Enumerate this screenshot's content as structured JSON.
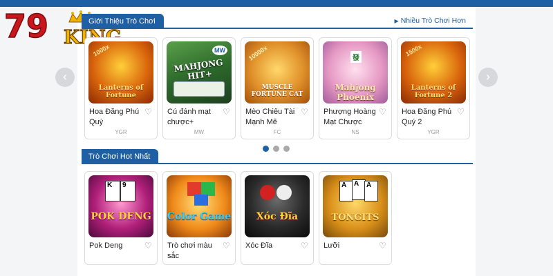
{
  "logo": {
    "text_79": "79",
    "text_king": "KING"
  },
  "intro_section": {
    "title": "Giới Thiệu Trò Chơi",
    "more_link": "Nhiều Trò Chơi Hơn",
    "cards": [
      {
        "name": "Hoa Đăng Phú Quý",
        "provider": "YGR",
        "thumb_title": "Lanterns of Fortune",
        "badge": "1000x"
      },
      {
        "name": "Cú đánh mạt chược+",
        "provider": "MW",
        "thumb_title": "MAHJONG HIT+",
        "badge": "MW"
      },
      {
        "name": "Mèo Chiêu Tài Mạnh Mẽ",
        "provider": "FC",
        "thumb_title": "MUSCLE FORTUNE CAT",
        "badge": "10000x"
      },
      {
        "name": "Phượng Hoàng Mạt Chược",
        "provider": "NS",
        "thumb_title": "Mahjong Phoenix",
        "badge": "發"
      },
      {
        "name": "Hoa Đăng Phú Quý 2",
        "provider": "YGR",
        "thumb_title": "Lanterns of Fortune 2",
        "badge": "1500x"
      }
    ],
    "prev_icon": "‹",
    "next_icon": "›"
  },
  "hot_section": {
    "title": "Trò Chơi Hot Nhất",
    "cards": [
      {
        "name": "Pok Deng",
        "thumb_title": "POK DENG"
      },
      {
        "name": "Trò chơi màu sắc",
        "thumb_title": "Color Game"
      },
      {
        "name": "Xóc Đĩa",
        "thumb_title": "Xóc Đĩa"
      },
      {
        "name": "Lưỡi",
        "thumb_title": "TONGITS"
      }
    ]
  },
  "icons": {
    "favorite": "heart-outline-icon",
    "more": "triangle-right-icon"
  },
  "colors": {
    "accent": "#1f5fa3",
    "page_bg": "#f4f5f6",
    "logo_red": "#c8181e",
    "logo_gold": "#f0b400"
  }
}
